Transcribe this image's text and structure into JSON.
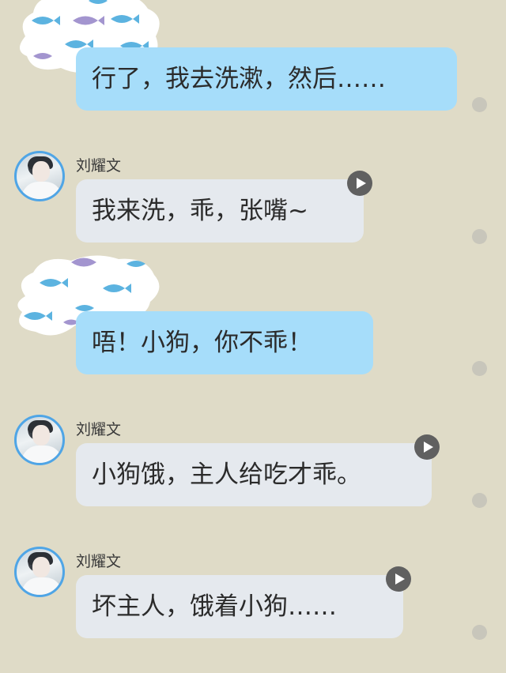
{
  "colors": {
    "background": "#dfdbc7",
    "my_bubble": "#a6ddfa",
    "other_bubble": "#e5e9ee",
    "avatar_border": "#4fa5e6",
    "fish_blue": "#5cb3e0",
    "fish_purple": "#a395cf"
  },
  "messages": [
    {
      "side": "me",
      "text": "行了，我去洗漱，然后……"
    },
    {
      "side": "other",
      "sender": "刘耀文",
      "text": "我来洗，乖，张嘴~",
      "has_voice": true
    },
    {
      "side": "me",
      "text": "唔！小狗，你不乖！"
    },
    {
      "side": "other",
      "sender": "刘耀文",
      "text": "小狗饿，主人给吃才乖。",
      "has_voice": true
    },
    {
      "side": "other",
      "sender": "刘耀文",
      "text": "坏主人，饿着小狗……",
      "has_voice": true
    }
  ]
}
